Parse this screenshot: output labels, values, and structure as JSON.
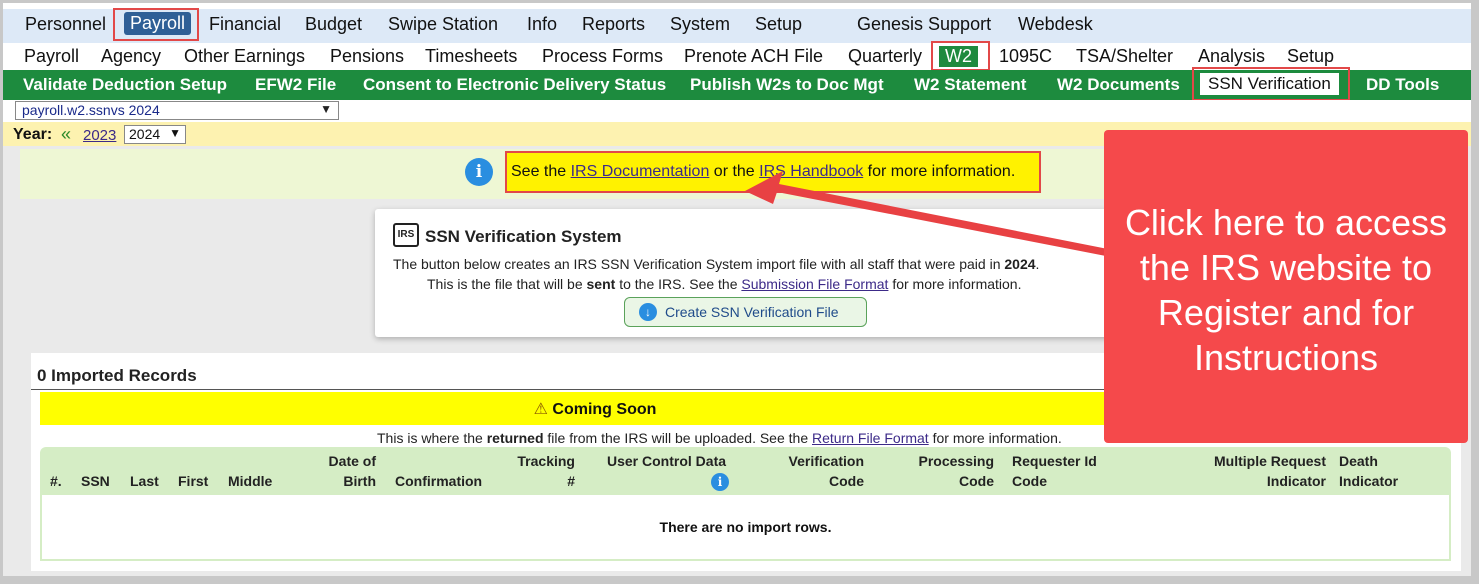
{
  "nav1": {
    "items": [
      "Personnel",
      "Payroll",
      "Financial",
      "Budget",
      "Swipe Station",
      "Info",
      "Reports",
      "System",
      "Setup",
      "Genesis Support",
      "Webdesk"
    ],
    "active": "Payroll"
  },
  "nav2": {
    "items": [
      "Payroll",
      "Agency",
      "Other Earnings",
      "Pensions",
      "Timesheets",
      "Process Forms",
      "Prenote ACH File",
      "Quarterly",
      "W2",
      "1095C",
      "TSA/Shelter",
      "Analysis",
      "Setup"
    ],
    "active": "W2"
  },
  "nav3": {
    "items": [
      "Validate Deduction Setup",
      "EFW2 File",
      "Consent to Electronic Delivery Status",
      "Publish W2s to Doc Mgt",
      "W2 Statement",
      "W2 Documents",
      "SSN Verification",
      "DD Tools"
    ],
    "active": "SSN Verification"
  },
  "page_select": "payroll.w2.ssnvs 2024",
  "year": {
    "label": "Year:",
    "prev": "2023",
    "current": "2024"
  },
  "info": {
    "prefix": "See the ",
    "link1": "IRS Documentation",
    "middle": " or the ",
    "link2": "IRS Handbook",
    "suffix": " for more information."
  },
  "card": {
    "title": "SSN Verification System",
    "line1_a": "The button below creates an IRS SSN Verification System import file with all staff that were paid in ",
    "line1_year": "2024",
    "line1_b": ".",
    "line2_a": "This is the file that will be ",
    "line2_bold": "sent",
    "line2_b": " to the IRS. See the ",
    "line2_link": "Submission File Format",
    "line2_c": " for more information.",
    "button": "Create SSN Verification File"
  },
  "records": {
    "header": "0 Imported Records",
    "coming_soon": "Coming Soon",
    "returned_a": "This is where the ",
    "returned_bold": "returned",
    "returned_b": " file from the IRS will be uploaded. See the ",
    "returned_link": "Return File Format",
    "returned_c": " for more information."
  },
  "table": {
    "columns": [
      "#.",
      "SSN",
      "Last",
      "First",
      "Middle",
      "Date of Birth",
      "Confirmation",
      "Tracking #",
      "User Control Data",
      "Verification Code",
      "Processing Code",
      "Requester Id Code",
      "Multiple Request Indicator",
      "Death Indicator"
    ],
    "empty_message": "There are no import rows."
  },
  "callout": {
    "text": "Click here to access the IRS website to Register and for Instructions",
    "color": "#f5494b"
  }
}
